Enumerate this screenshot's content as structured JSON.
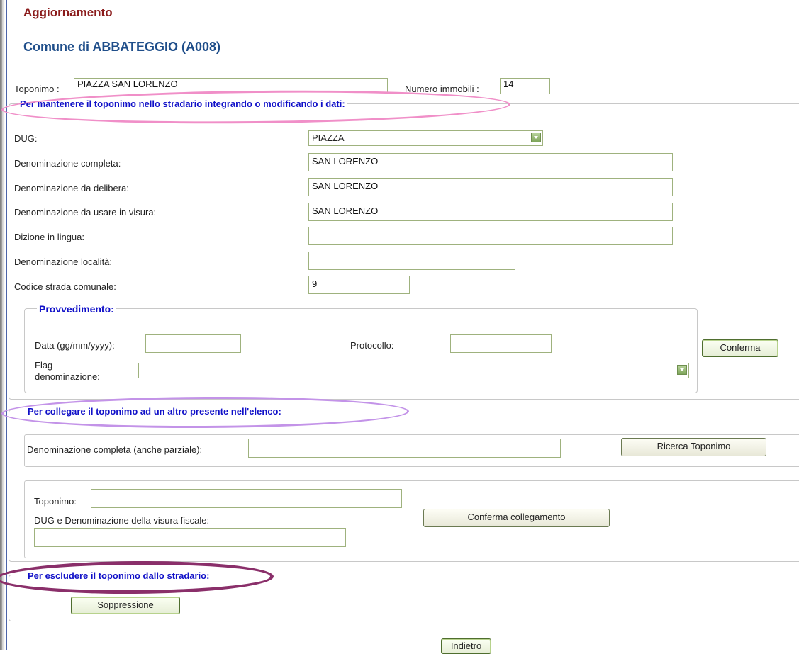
{
  "header": {
    "title": "Aggiornamento",
    "comune": "Comune di ABBATEGGIO (A008)"
  },
  "top_fields": {
    "toponimo_label": "Toponimo :",
    "toponimo_value": "PIAZZA SAN LORENZO",
    "numero_immobili_label": "Numero immobili :",
    "numero_immobili_value": "14"
  },
  "section_maintain": {
    "legend": "Per mantenere il toponimo nello stradario integrando o modificando i dati:",
    "dug_label": "DUG:",
    "dug_value": "PIAZZA",
    "den_completa_label": "Denominazione completa:",
    "den_completa_value": "SAN LORENZO",
    "den_delibera_label": "Denominazione da delibera:",
    "den_delibera_value": "SAN LORENZO",
    "den_visura_label": "Denominazione da usare in visura:",
    "den_visura_value": "SAN LORENZO",
    "dizione_label": "Dizione in lingua:",
    "dizione_value": "",
    "localita_label": "Denominazione località:",
    "localita_value": "",
    "codice_label": "Codice strada comunale:",
    "codice_value": "9",
    "provvedimento": {
      "legend": "Provvedimento:",
      "data_label": "Data (gg/mm/yyyy):",
      "data_value": "",
      "protocollo_label": "Protocollo:",
      "protocollo_value": "",
      "flag_label_1": "Flag",
      "flag_label_2": "denominazione:",
      "flag_value": ""
    },
    "confirm_button": "Conferma"
  },
  "section_link": {
    "legend": "Per collegare il toponimo ad un altro presente nell'elenco:",
    "search_label": "Denominazione completa (anche parziale):",
    "search_value": "",
    "search_button": "Ricerca Toponimo",
    "toponimo_label": "Toponimo:",
    "toponimo_value": "",
    "dug_visura_label": "DUG e Denominazione della visura fiscale:",
    "dug_visura_value": "",
    "confirm_link_button": "Conferma collegamento"
  },
  "section_exclude": {
    "legend": "Per escludere il toponimo dallo stradario:",
    "suppress_button": "Soppressione"
  },
  "footer": {
    "back_button": "Indietro"
  },
  "colors": {
    "title": "#8b1c1c",
    "comune_title": "#1f4e8a",
    "legend_text": "#1010c8",
    "input_border": "#9fb27e",
    "highlight_pink": "#f08fc8",
    "highlight_lilac": "#c393e8",
    "highlight_plum": "#8a2f6a"
  }
}
